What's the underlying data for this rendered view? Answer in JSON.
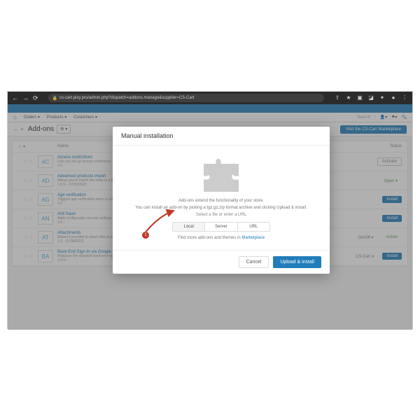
{
  "browser": {
    "url": "cs-cart.pixy.pro/admin.php?dispatch=addons.manage&supplier=CS-Cart"
  },
  "menubar": {
    "items": [
      "Orders ▾",
      "Products ▾",
      "Customers ▾"
    ],
    "search_placeholder": "Search"
  },
  "page": {
    "title": "Add-ons",
    "marketplace_btn": "Visit the CS-Cart Marketplace",
    "gear": "⚙ ▾"
  },
  "thead": {
    "star": "☆ ▾",
    "name": "Name",
    "status": "Status"
  },
  "rows": [
    {
      "code": "AC",
      "name": "Access restrictions",
      "desc": "Lets you set up access restrictions",
      "ver": "1.0",
      "status": "Activate",
      "cls": "st-act"
    },
    {
      "code": "AD",
      "name": "Advanced products import",
      "desc": "Allows you to match the fields in a file with product properties. Those import presets can be run automatically",
      "ver": "1.0.0 – 07/03/2022",
      "status": "Open ▾",
      "cls": "st-open"
    },
    {
      "code": "AG",
      "name": "Age verification",
      "desc": "Triggers age verification when a customer visits pages with age-restricted products",
      "ver": "1.0",
      "status": "Install",
      "cls": "st-ins"
    },
    {
      "code": "AN",
      "name": "Anti fraud",
      "desc": "Adds configurable security settings to protect your store from fraud",
      "ver": "1.0 –",
      "status": "Install",
      "cls": "st-ins"
    },
    {
      "code": "AT",
      "name": "Attachments",
      "desc": "Makes it possible to attach files to products",
      "ver": "1.0 – 07/08/2022",
      "status": "Active",
      "cls": "st-on",
      "extra": "On/Off ▾"
    },
    {
      "code": "BA",
      "name": "Back-End Sign-In via Google",
      "desc": "Replaces the standard back-end sign-in mechanism with authentication via Google accounts",
      "ver": "1.0.0 –",
      "status": "Install",
      "cls": "st-ins",
      "extra": "CS-Cart ▾"
    }
  ],
  "modal": {
    "title": "Manual installation",
    "line1": "Add-ons extend the functionality of your store.",
    "line2": "You can install an add-on by picking a tgz,gz,zip format archive and clicking Upload & install.",
    "select_label": "Select a file or enter a URL",
    "tabs": [
      "Local",
      "Server",
      "URL"
    ],
    "more_prefix": "Find more add-ons and themes in ",
    "more_link": "Marketplace",
    "cancel": "Cancel",
    "upload": "Upload & install"
  },
  "marker": "1"
}
